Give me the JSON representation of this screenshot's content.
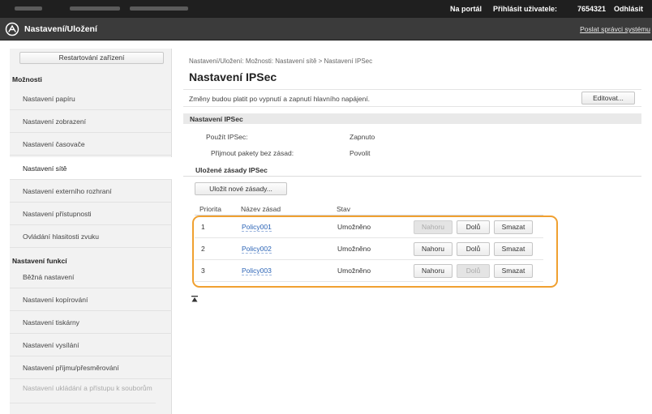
{
  "topbar": {
    "portal_link": "Na portál",
    "login_label": "Přihlásit uživatele:",
    "user_id": "7654321",
    "logout": "Odhlásit"
  },
  "header": {
    "title": "Nastavení/Uložení",
    "send_link": "Poslat správci systému"
  },
  "sidebar": {
    "restart_button": "Restartování zařízení",
    "section_moznosti": "Možnosti",
    "items_moznosti": [
      "Nastavení papíru",
      "Nastavení zobrazení",
      "Nastavení časovače",
      "Nastavení sítě",
      "Nastavení externího rozhraní",
      "Nastavení přístupnosti",
      "Ovládání hlasitosti zvuku"
    ],
    "section_funkce": "Nastavení funkcí",
    "items_funkce": [
      "Běžná nastavení",
      "Nastavení kopírování",
      "Nastavení tiskárny",
      "Nastavení vysílání",
      "Nastavení příjmu/přesměrování",
      "Nastavení ukládání a přístupu k souborům"
    ]
  },
  "main": {
    "breadcrumb": "Nastavení/Uložení: Možnosti: Nastavení sítě > Nastavení IPSec",
    "title": "Nastavení IPSec",
    "notice": "Změny budou platit po vypnutí a zapnutí hlavního napájení.",
    "edit_button": "Editovat...",
    "section_title": "Nastavení IPSec",
    "use_ipsec_label": "Použít IPSec:",
    "use_ipsec_value": "Zapnuto",
    "accept_label": "Přijmout pakety bez zásad:",
    "accept_value": "Povolit",
    "registered_heading": "Uložené zásady IPSec",
    "save_new_button": "Uložit nové zásady...",
    "columns": [
      "Priorita",
      "Název zásad",
      "Stav"
    ],
    "policies": [
      {
        "priority": "1",
        "name": "Policy001",
        "state": "Umožněno",
        "up": "Nahoru",
        "down": "Dolů",
        "delete": "Smazat"
      },
      {
        "priority": "2",
        "name": "Policy002",
        "state": "Umožněno",
        "up": "Nahoru",
        "down": "Dolů",
        "delete": "Smazat"
      },
      {
        "priority": "3",
        "name": "Policy003",
        "state": "Umožněno",
        "up": "Nahoru",
        "down": "Dolů",
        "delete": "Smazat"
      }
    ]
  },
  "colors": {
    "topbar": "#1f1f1f",
    "header": "#3b3b3b",
    "highlight": "#f0a030",
    "link": "#2a63b6"
  }
}
